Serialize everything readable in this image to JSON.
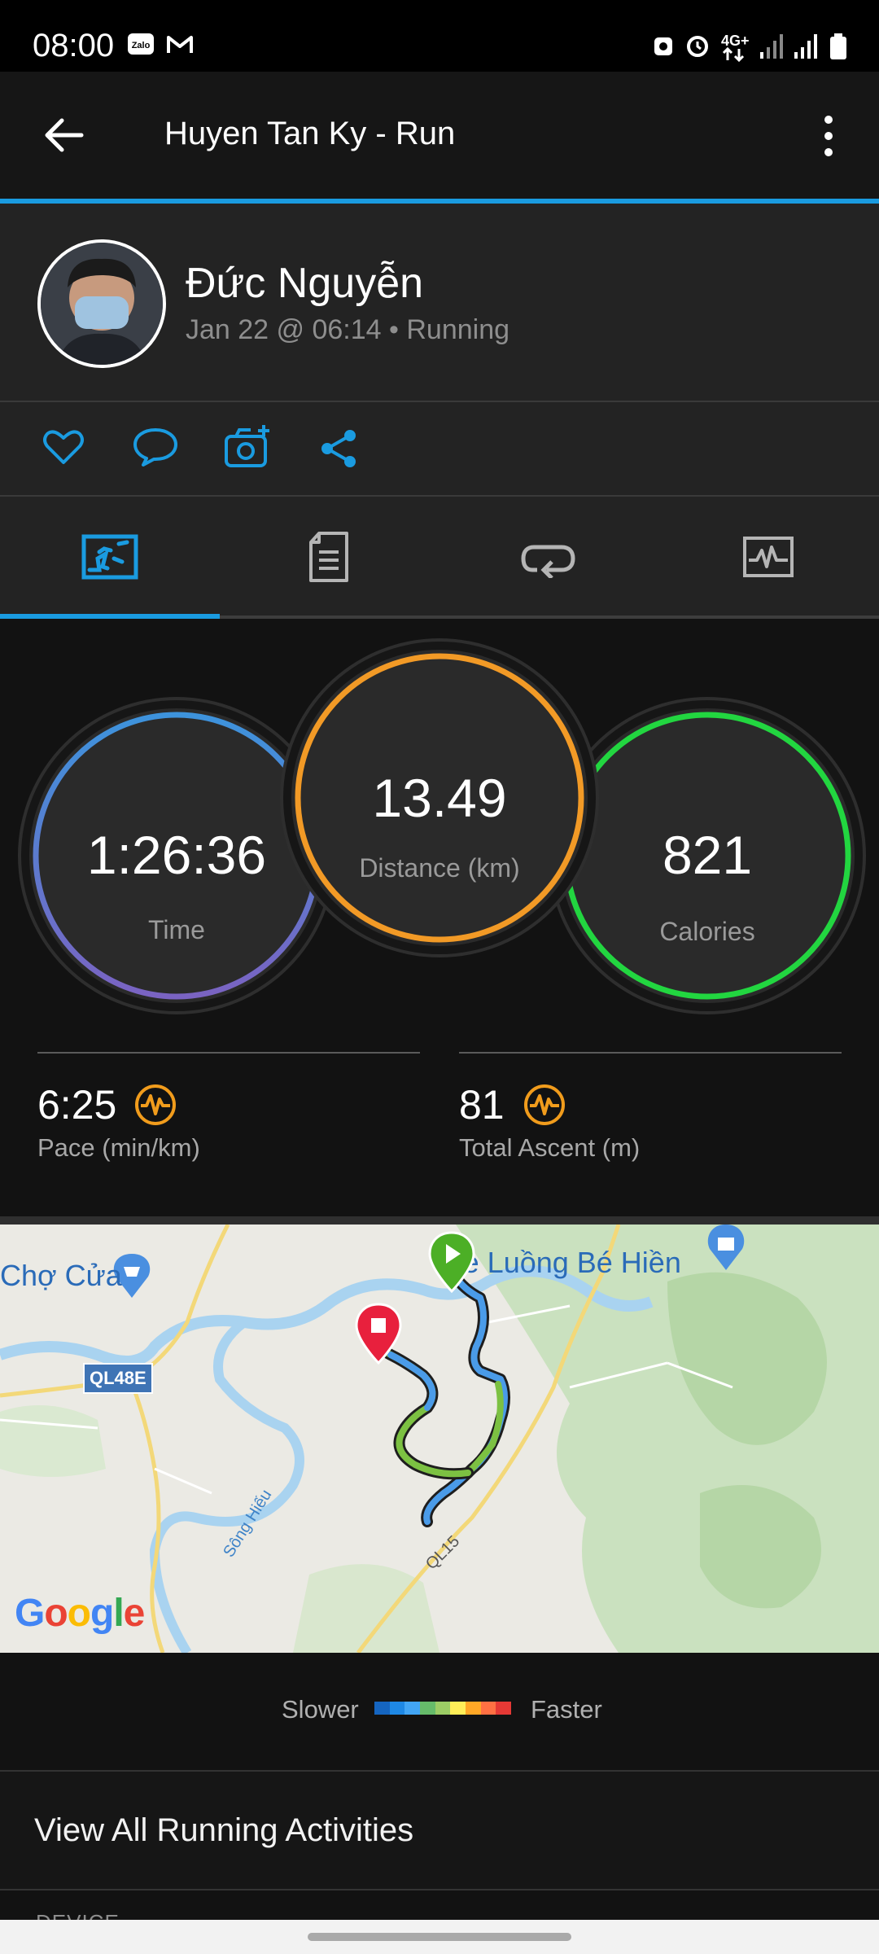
{
  "status_bar": {
    "time": "08:00",
    "left_icons": [
      "zalo-icon",
      "gmail-icon"
    ],
    "right_icons": [
      "mute-icon",
      "alarm-icon",
      "4g-data-icon",
      "signal-1-icon",
      "signal-2-icon",
      "battery-icon"
    ],
    "network_label": "4G+"
  },
  "app_bar": {
    "title": "Huyen Tan Ky - Run",
    "back_icon": "arrow-left-icon",
    "menu_icon": "more-vert-icon"
  },
  "profile": {
    "name": "Đức Nguyễn",
    "subtitle": "Jan 22 @ 06:14 • Running"
  },
  "actions": [
    "heart-icon",
    "comment-icon",
    "add-photo-icon",
    "share-icon"
  ],
  "tabs": [
    {
      "icon": "overview-icon",
      "active": true
    },
    {
      "icon": "details-icon",
      "active": false
    },
    {
      "icon": "laps-icon",
      "active": false
    },
    {
      "icon": "charts-icon",
      "active": false
    }
  ],
  "stats": {
    "time": {
      "value": "1:26:36",
      "label": "Time"
    },
    "distance": {
      "value": "13.49",
      "label": "Distance (km)"
    },
    "calories": {
      "value": "821",
      "label": "Calories"
    },
    "pace": {
      "value": "6:25",
      "label": "Pace (min/km)"
    },
    "ascent": {
      "value": "81",
      "label": "Total Ascent (m)"
    }
  },
  "map": {
    "labels": {
      "place_1": "Chợ Cửa",
      "place_2": "Tre Luồng Bé Hiền",
      "road_1": "QL48E",
      "road_2": "QL15",
      "river": "Sông Hiếu",
      "attribution": "Google"
    }
  },
  "legend": {
    "slower": "Slower",
    "faster": "Faster",
    "colors": [
      "#1565c0",
      "#1e88e5",
      "#42a5f5",
      "#66bb6a",
      "#9ccc65",
      "#ffee58",
      "#ffa726",
      "#ff7043",
      "#e53935"
    ]
  },
  "view_all": "View All Running Activities",
  "device_label": "DEVICE",
  "colors": {
    "accent": "#1a9be0",
    "time_ring": "#4a8fd8",
    "distance_ring": "#f29a26",
    "calories_ring": "#22d640"
  }
}
